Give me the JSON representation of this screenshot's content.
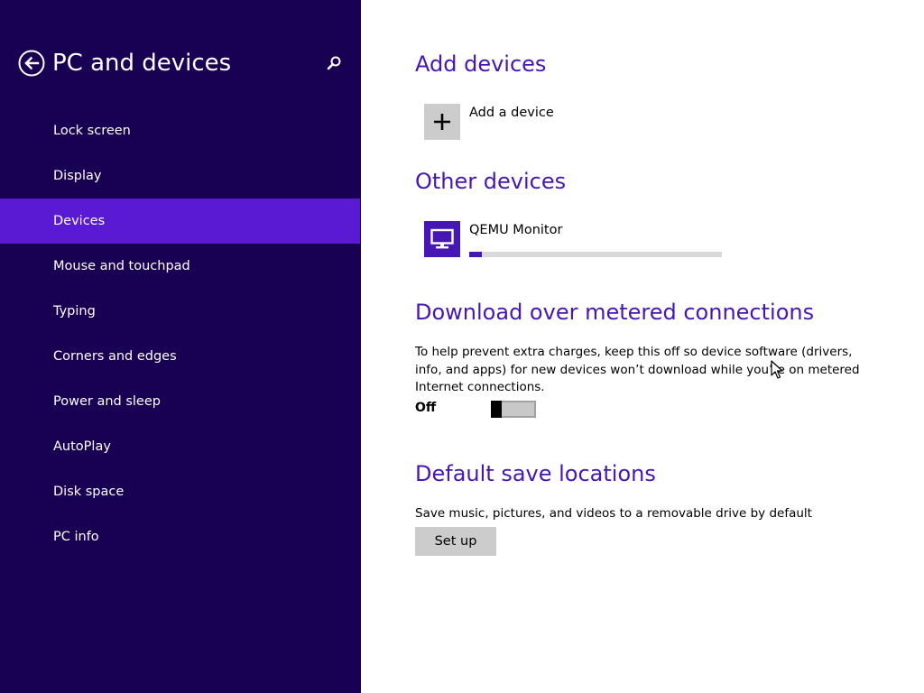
{
  "colors": {
    "sidebar_bg": "#180052",
    "selected_bg": "#5a1ad4",
    "accent": "#4617b4"
  },
  "sidebar": {
    "title": "PC and devices",
    "back_icon": "back-arrow-icon",
    "search_icon": "search-icon",
    "items": [
      {
        "label": "Lock screen",
        "selected": false
      },
      {
        "label": "Display",
        "selected": false
      },
      {
        "label": "Devices",
        "selected": true
      },
      {
        "label": "Mouse and touchpad",
        "selected": false
      },
      {
        "label": "Typing",
        "selected": false
      },
      {
        "label": "Corners and edges",
        "selected": false
      },
      {
        "label": "Power and sleep",
        "selected": false
      },
      {
        "label": "AutoPlay",
        "selected": false
      },
      {
        "label": "Disk space",
        "selected": false
      },
      {
        "label": "PC info",
        "selected": false
      }
    ]
  },
  "main": {
    "add_devices": {
      "heading": "Add devices",
      "add_label": "Add a device",
      "icon": "plus-icon"
    },
    "other_devices": {
      "heading": "Other devices",
      "devices": [
        {
          "name": "QEMU Monitor",
          "icon": "monitor-icon",
          "progress": 0.05
        }
      ]
    },
    "metered": {
      "heading": "Download over metered connections",
      "description": "To help prevent extra charges, keep this off so device software (drivers, info, and apps) for new devices won’t download while you’re on metered Internet connections.",
      "toggle_state": "Off",
      "toggle_on": false
    },
    "save_locations": {
      "heading": "Default save locations",
      "description": "Save music, pictures, and videos to a removable drive by default",
      "button_label": "Set up"
    }
  }
}
